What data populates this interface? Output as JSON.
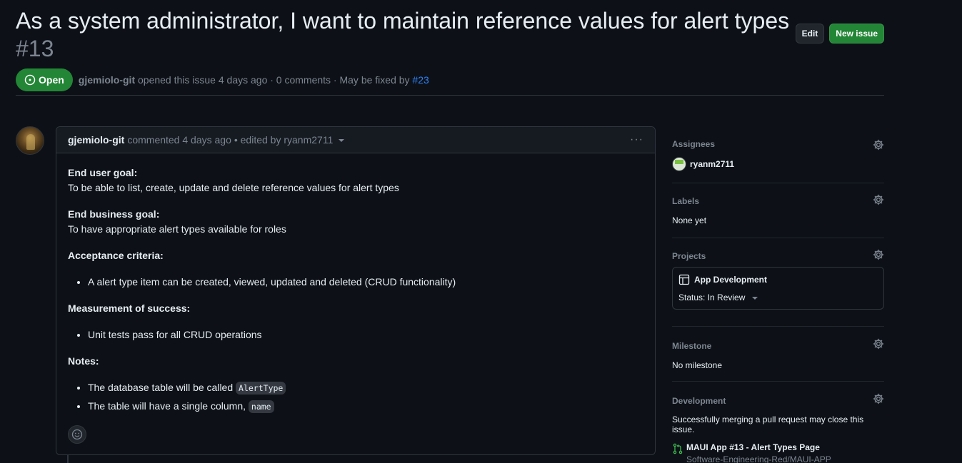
{
  "issue": {
    "title": "As a system administrator, I want to maintain reference values for alert types",
    "number": "#13",
    "state": "Open",
    "author": "gjemiolo-git",
    "meta_opened": " opened this issue 4 days ago · 0 comments · May be fixed by ",
    "linked_pr": "#23"
  },
  "header_actions": {
    "edit_label": "Edit",
    "new_issue_label": "New issue"
  },
  "comment": {
    "author": "gjemiolo-git",
    "action": "commented 4 days ago",
    "edited": "• edited by ryanm2711",
    "kebab": "···",
    "sections": {
      "goal_heading": "End user goal:",
      "goal_text": "To be able to list, create, update and delete reference values for alert types",
      "business_heading": "End business goal:",
      "business_text": "To have appropriate alert types available for roles",
      "acceptance_heading": "Acceptance criteria:",
      "acceptance_item": "A alert type item can be created, viewed, updated and deleted (CRUD functionality)",
      "measure_heading": "Measurement of success:",
      "measure_item": "Unit tests pass for all CRUD operations",
      "notes_heading": "Notes:",
      "note1_prefix": "The database table will be called ",
      "note1_code": "AlertType",
      "note2_prefix": "The table will have a single column, ",
      "note2_code": "name"
    }
  },
  "sidebar": {
    "assignees": {
      "title": "Assignees",
      "user": "ryanm2711"
    },
    "labels": {
      "title": "Labels",
      "value": "None yet"
    },
    "projects": {
      "title": "Projects",
      "project_name": "App Development",
      "status": "Status: In Review"
    },
    "milestone": {
      "title": "Milestone",
      "value": "No milestone"
    },
    "development": {
      "title": "Development",
      "hint": "Successfully merging a pull request may close this issue.",
      "pr_title": "MAUI App #13 - Alert Types Page",
      "pr_repo": "Software-Engineering-Red/MAUI-APP"
    }
  },
  "colors": {
    "background": "#0d1117",
    "open_green": "#238636",
    "link_blue": "#2f81f7",
    "muted": "#7d8590",
    "border": "#30363d"
  }
}
